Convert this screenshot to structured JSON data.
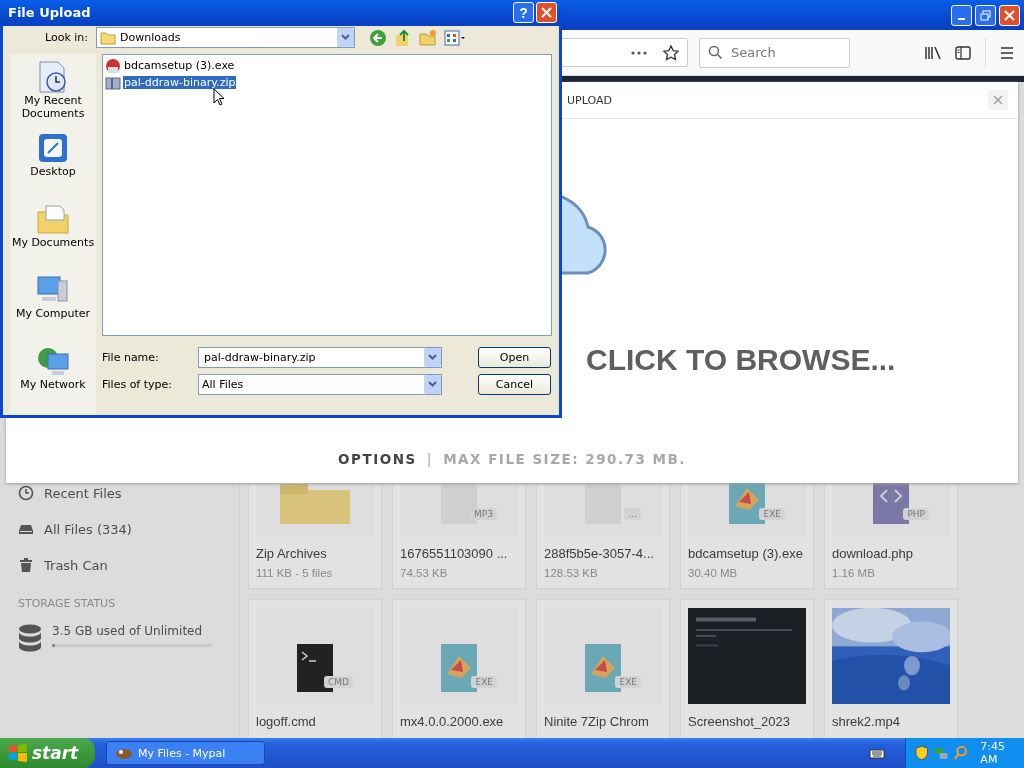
{
  "browser": {
    "search": {
      "placeholder": "Search"
    }
  },
  "sidebar": {
    "items": [
      {
        "label": "Recent Files",
        "kind": "recent"
      },
      {
        "label": "All Files (334)",
        "kind": "all"
      },
      {
        "label": "Trash Can",
        "kind": "trash"
      }
    ],
    "storage": {
      "heading": "STORAGE STATUS",
      "text": "3.5 GB used of Unlimited",
      "level": 0.02
    }
  },
  "files": [
    {
      "name": "Zip Archives",
      "size": "111 KB - 5 files",
      "kind": "folder"
    },
    {
      "name": "1676551103090 ...",
      "size": "74.53 KB",
      "kind": "doc",
      "badge": "MP3"
    },
    {
      "name": "288f5b5e-3057-4...",
      "size": "128.53 KB",
      "kind": "doc",
      "badge": "..."
    },
    {
      "name": "bdcamsetup (3).exe",
      "size": "30.40 MB",
      "kind": "exe",
      "badge": "EXE"
    },
    {
      "name": "download.php",
      "size": "1.16 MB",
      "kind": "php",
      "badge": "PHP"
    },
    {
      "name": "logoff.cmd",
      "kind": "cmd",
      "badge": "CMD"
    },
    {
      "name": "mx4.0.0.2000.exe",
      "kind": "exe",
      "badge": "EXE"
    },
    {
      "name": "Ninite 7Zip Chrom",
      "kind": "exe",
      "badge": "EXE"
    },
    {
      "name": "Screenshot_2023",
      "kind": "screenshot"
    },
    {
      "name": "shrek2.mp4",
      "kind": "video"
    }
  ],
  "upload_modal": {
    "title": "UPLOAD",
    "prompt": "CLICK TO BROWSE...",
    "options": "OPTIONS",
    "separator": "|",
    "max_size": "MAX FILE SIZE: 290.73 MB."
  },
  "dialog": {
    "title": "File Upload",
    "help": "?",
    "look_in_label": "Look in:",
    "look_in": "Downloads",
    "places": [
      {
        "label": "My Recent Documents",
        "kind": "recent"
      },
      {
        "label": "Desktop",
        "kind": "desktop"
      },
      {
        "label": "My Documents",
        "kind": "documents"
      },
      {
        "label": "My Computer",
        "kind": "computer"
      },
      {
        "label": "My Network",
        "kind": "network"
      }
    ],
    "files": [
      {
        "name": "bdcamsetup (3).exe",
        "kind": "exe",
        "selected": false
      },
      {
        "name": "pal-ddraw-binary.zip",
        "kind": "zip",
        "selected": true
      }
    ],
    "file_name_label": "File name:",
    "file_name": "pal-ddraw-binary.zip",
    "file_type_label": "Files of type:",
    "file_type": "All Files",
    "buttons": [
      "Open",
      "Cancel"
    ]
  },
  "taskbar": {
    "start": "start",
    "tasks": [
      {
        "label": "My Files - Mypal",
        "selected": false
      }
    ],
    "clock": "7:45 AM"
  }
}
